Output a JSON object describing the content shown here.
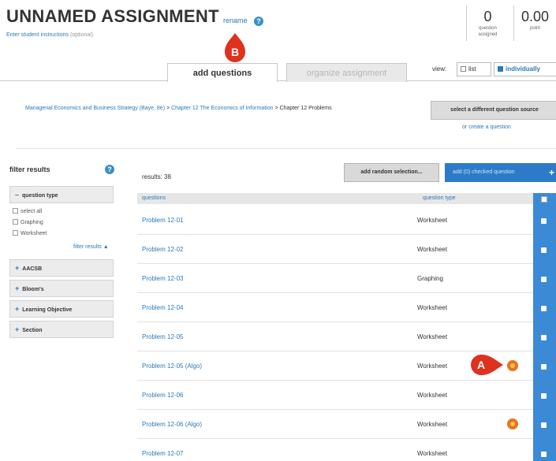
{
  "header": {
    "title": "UNNAMED ASSIGNMENT",
    "rename": "rename",
    "instructions_link": "Enter student instructions",
    "instructions_optional": "(optional)"
  },
  "stats": [
    {
      "value": "0",
      "label_line1": "question",
      "label_line2": "assigned"
    },
    {
      "value": "0.00",
      "label_line1": "point",
      "label_line2": ""
    }
  ],
  "callouts": {
    "a": "A",
    "b": "B"
  },
  "tabs": {
    "add": "add questions",
    "organize": "organize assignment"
  },
  "view": {
    "label": "view:",
    "list": "list",
    "individually": "individually"
  },
  "breadcrumb": {
    "book": "Managerial Economics and Business Strategy (Baye, 8e)",
    "sep": ">",
    "chapter": "Chapter 12 The Economics of Information",
    "tail": "> Chapter 12 Problems"
  },
  "source": {
    "button": "select a different question source",
    "or": "or",
    "create": "create a question"
  },
  "filter": {
    "title": "filter results",
    "question_type": "question type",
    "options": [
      "select all",
      "Graphing",
      "Worksheet"
    ],
    "link": "filter results ▲",
    "groups": [
      "AACSB",
      "Bloom's",
      "Learning Objective",
      "Section"
    ]
  },
  "results": {
    "label": "results: 38",
    "random_button": "add random selection...",
    "add_button": "add (0) checked question"
  },
  "table": {
    "col_questions": "questions",
    "col_type": "question type",
    "rows": [
      {
        "name": "Problem 12-01",
        "type": "Worksheet"
      },
      {
        "name": "Problem 12-02",
        "type": "Worksheet"
      },
      {
        "name": "Problem 12-03",
        "type": "Graphing"
      },
      {
        "name": "Problem 12-04",
        "type": "Worksheet"
      },
      {
        "name": "Problem 12-05",
        "type": "Worksheet"
      },
      {
        "name": "Problem 12-05 (Algo)",
        "type": "Worksheet"
      },
      {
        "name": "Problem 12-06",
        "type": "Worksheet"
      },
      {
        "name": "Problem 12-06 (Algo)",
        "type": "Worksheet"
      },
      {
        "name": "Problem 12-07",
        "type": "Worksheet"
      }
    ]
  },
  "colors": {
    "accent": "#2a7ab8",
    "blue_column": "#3a8ad6",
    "callout": "#e0301e",
    "algo": "#e8731f"
  }
}
